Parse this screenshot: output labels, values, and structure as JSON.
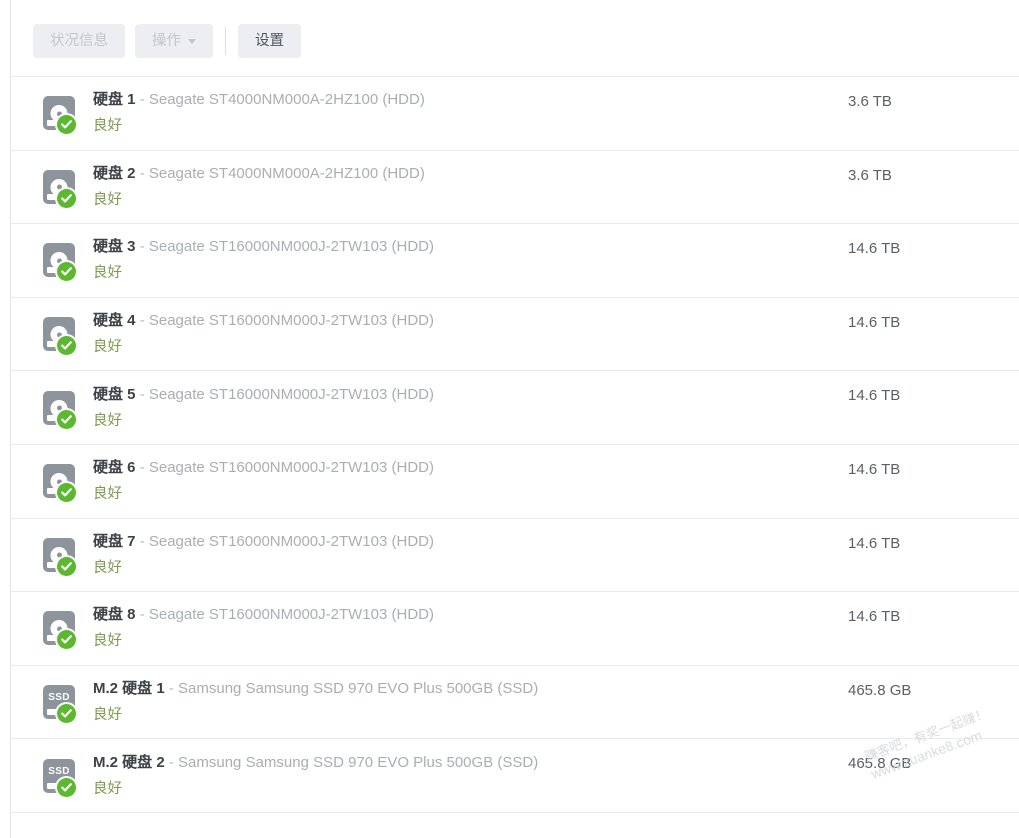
{
  "toolbar": {
    "health_info_label": "状况信息",
    "action_label": "操作",
    "settings_label": "设置",
    "caret_icon": "chevron-down-icon",
    "divider": "|"
  },
  "colors": {
    "status_ok": "#7d9a4f",
    "badge_green": "#5cb82e",
    "drive_gray": "#8e949c",
    "title_dark": "#3c4248",
    "model_gray": "#a9aeb5",
    "row_border": "#e9ebee",
    "button_bg": "#eceef1",
    "button_disabled_text": "#c2c6cc",
    "button_text": "#4c5661"
  },
  "disks": [
    {
      "icon": "hdd-icon",
      "label": "硬盘 1",
      "label_prefix": "硬盘",
      "label_index": "1",
      "dash": "-",
      "model": "Seagate ST4000NM000A-2HZ100 (HDD)",
      "status": "良好",
      "capacity": "3.6 TB",
      "type": "HDD"
    },
    {
      "icon": "hdd-icon",
      "label": "硬盘 2",
      "label_prefix": "硬盘",
      "label_index": "2",
      "dash": "-",
      "model": "Seagate ST4000NM000A-2HZ100 (HDD)",
      "status": "良好",
      "capacity": "3.6 TB",
      "type": "HDD"
    },
    {
      "icon": "hdd-icon",
      "label": "硬盘 3",
      "label_prefix": "硬盘",
      "label_index": "3",
      "dash": "-",
      "model": "Seagate ST16000NM000J-2TW103 (HDD)",
      "status": "良好",
      "capacity": "14.6 TB",
      "type": "HDD"
    },
    {
      "icon": "hdd-icon",
      "label": "硬盘 4",
      "label_prefix": "硬盘",
      "label_index": "4",
      "dash": "-",
      "model": "Seagate ST16000NM000J-2TW103 (HDD)",
      "status": "良好",
      "capacity": "14.6 TB",
      "type": "HDD"
    },
    {
      "icon": "hdd-icon",
      "label": "硬盘 5",
      "label_prefix": "硬盘",
      "label_index": "5",
      "dash": "-",
      "model": "Seagate ST16000NM000J-2TW103 (HDD)",
      "status": "良好",
      "capacity": "14.6 TB",
      "type": "HDD"
    },
    {
      "icon": "hdd-icon",
      "label": "硬盘 6",
      "label_prefix": "硬盘",
      "label_index": "6",
      "dash": "-",
      "model": "Seagate ST16000NM000J-2TW103 (HDD)",
      "status": "良好",
      "capacity": "14.6 TB",
      "type": "HDD"
    },
    {
      "icon": "hdd-icon",
      "label": "硬盘 7",
      "label_prefix": "硬盘",
      "label_index": "7",
      "dash": "-",
      "model": "Seagate ST16000NM000J-2TW103 (HDD)",
      "status": "良好",
      "capacity": "14.6 TB",
      "type": "HDD"
    },
    {
      "icon": "hdd-icon",
      "label": "硬盘 8",
      "label_prefix": "硬盘",
      "label_index": "8",
      "dash": "-",
      "model": "Seagate ST16000NM000J-2TW103 (HDD)",
      "status": "良好",
      "capacity": "14.6 TB",
      "type": "HDD"
    },
    {
      "icon": "ssd-icon",
      "label": "M.2 硬盘 1",
      "label_prefix": "M.2 硬盘",
      "label_index": "1",
      "dash": "-",
      "model": "Samsung Samsung SSD 970 EVO Plus 500GB (SSD)",
      "status": "良好",
      "capacity": "465.8 GB",
      "type": "SSD",
      "icon_text": "SSD"
    },
    {
      "icon": "ssd-icon",
      "label": "M.2 硬盘 2",
      "label_prefix": "M.2 硬盘",
      "label_index": "2",
      "dash": "-",
      "model": "Samsung Samsung SSD 970 EVO Plus 500GB (SSD)",
      "status": "良好",
      "capacity": "465.8 GB",
      "type": "SSD",
      "icon_text": "SSD"
    }
  ],
  "watermark": {
    "line1": "赚客吧，有奖一起赚！",
    "line2": "www.zuanke8.com"
  }
}
